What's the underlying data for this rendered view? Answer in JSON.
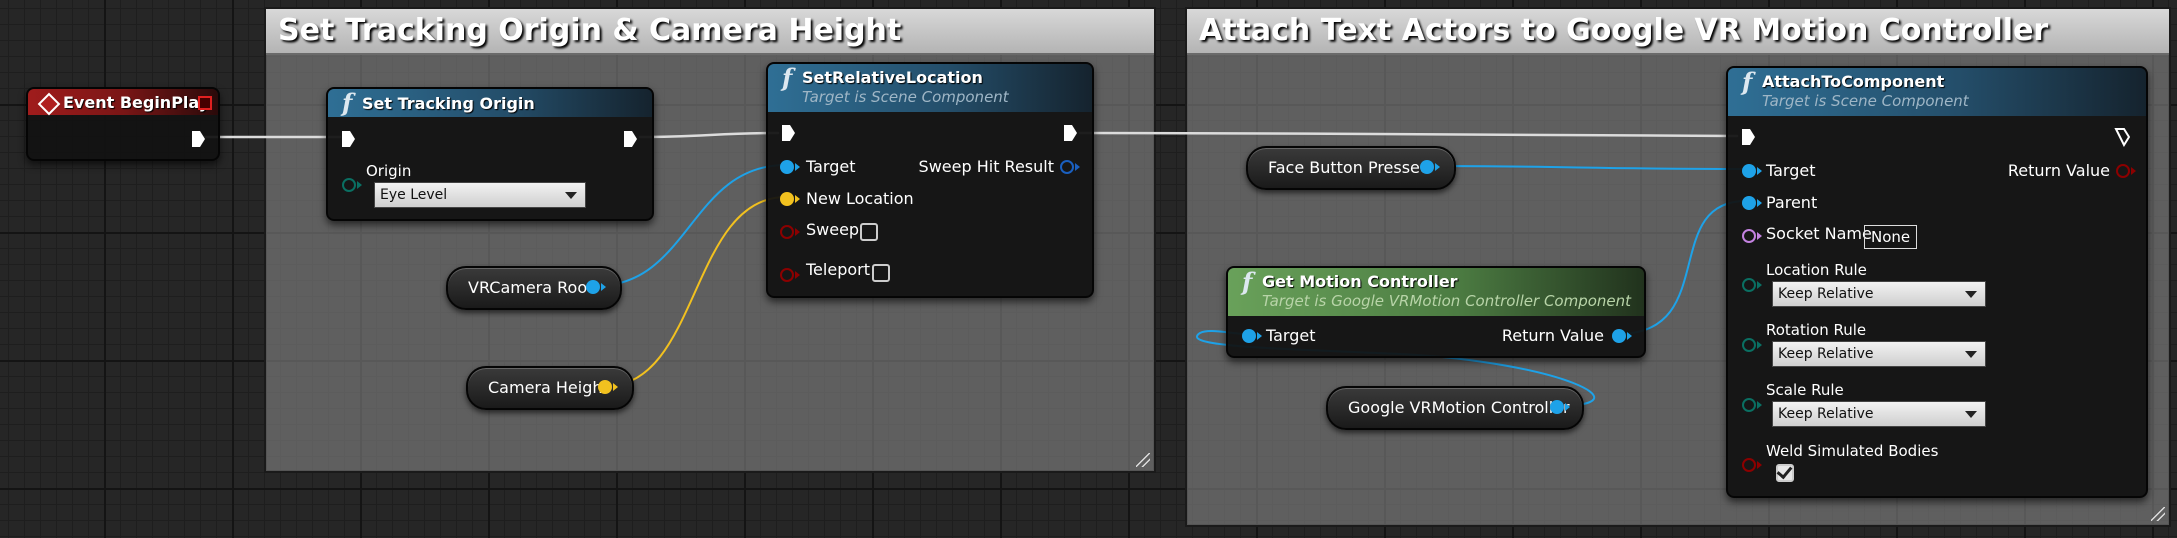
{
  "comments": [
    {
      "title": "Set Tracking Origin & Camera Height"
    },
    {
      "title": "Attach Text Actors to Google VR Motion Controller"
    }
  ],
  "nodes": {
    "event_beginplay": {
      "title": "Event BeginPlay"
    },
    "set_tracking_origin": {
      "title": "Set Tracking Origin",
      "origin_label": "Origin",
      "origin_value": "Eye Level"
    },
    "set_relative_location": {
      "title": "SetRelativeLocation",
      "subtitle": "Target is Scene Component",
      "target_label": "Target",
      "new_location_label": "New Location",
      "sweep_label": "Sweep",
      "teleport_label": "Teleport",
      "sweep_hit_result_label": "Sweep Hit Result"
    },
    "get_motion_controller": {
      "title": "Get Motion Controller",
      "subtitle": "Target is Google VRMotion Controller Component",
      "target_label": "Target",
      "return_value_label": "Return Value"
    },
    "attach_to_component": {
      "title": "AttachToComponent",
      "subtitle": "Target is Scene Component",
      "target_label": "Target",
      "parent_label": "Parent",
      "socket_name_label": "Socket Name",
      "socket_name_value": "None",
      "location_rule_label": "Location Rule",
      "location_rule_value": "Keep Relative",
      "rotation_rule_label": "Rotation Rule",
      "rotation_rule_value": "Keep Relative",
      "scale_rule_label": "Scale Rule",
      "scale_rule_value": "Keep Relative",
      "weld_label": "Weld Simulated Bodies",
      "return_value_label": "Return Value"
    }
  },
  "variables": {
    "vr_camera_root": "VRCamera Root",
    "camera_height": "Camera Height",
    "face_button_pressed": "Face Button Pressed",
    "google_vr_motion_controller": "Google VRMotion Controller"
  },
  "colors": {
    "exec": "#ffffff",
    "object": "#1ea2e8",
    "vector": "#f2c11f",
    "bool": "#8c0000",
    "name": "#c382e0",
    "enum": "#0a6f62",
    "event_header": "#a01c1c",
    "function_header": "#2f6f95",
    "pure_header": "#69a15a"
  }
}
